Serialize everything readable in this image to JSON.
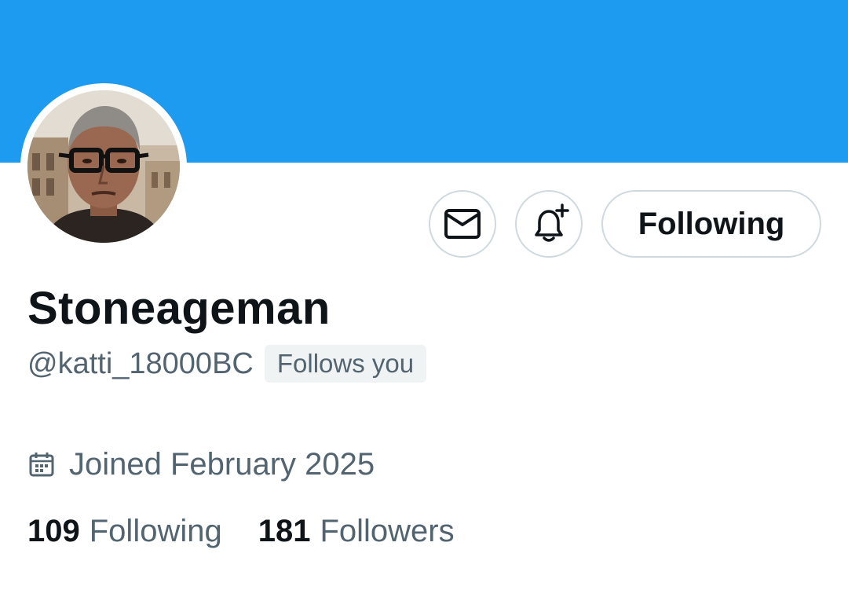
{
  "profile": {
    "display_name": "Stoneageman",
    "handle": "@katti_18000BC",
    "follows_you_badge": "Follows you",
    "joined": "Joined February 2025",
    "following_count": "109",
    "following_label": "Following",
    "followers_count": "181",
    "followers_label": "Followers"
  },
  "actions": {
    "message_icon": "envelope-icon",
    "notify_icon": "bell-plus-icon",
    "follow_state_label": "Following"
  },
  "icons": {
    "joined_icon": "calendar-icon"
  },
  "colors": {
    "banner": "#1d9bf0",
    "primary_text": "#0f1419",
    "secondary_text": "#536471",
    "border": "#cfd9de",
    "badge_bg": "#eff3f4"
  }
}
